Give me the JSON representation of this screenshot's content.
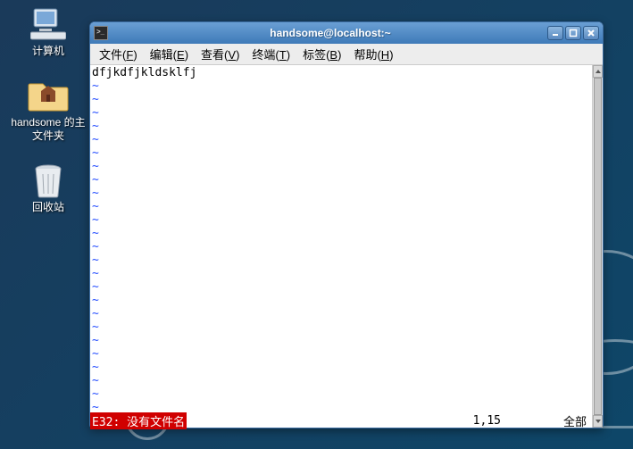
{
  "desktop": {
    "icons": [
      {
        "label": "计算机",
        "type": "computer"
      },
      {
        "label": "handsome 的主文件夹",
        "type": "folder"
      },
      {
        "label": "回收站",
        "type": "trash"
      }
    ]
  },
  "window": {
    "title": "handsome@localhost:~",
    "menu": [
      {
        "label": "文件",
        "accel": "F"
      },
      {
        "label": "编辑",
        "accel": "E"
      },
      {
        "label": "查看",
        "accel": "V"
      },
      {
        "label": "终端",
        "accel": "T"
      },
      {
        "label": "标签",
        "accel": "B"
      },
      {
        "label": "帮助",
        "accel": "H"
      }
    ]
  },
  "terminal": {
    "content_line": "dfjkdfjkldsklfj",
    "tilde": "~",
    "status": {
      "error": "E32: 没有文件名",
      "position": "1,15",
      "scope": "全部"
    }
  }
}
